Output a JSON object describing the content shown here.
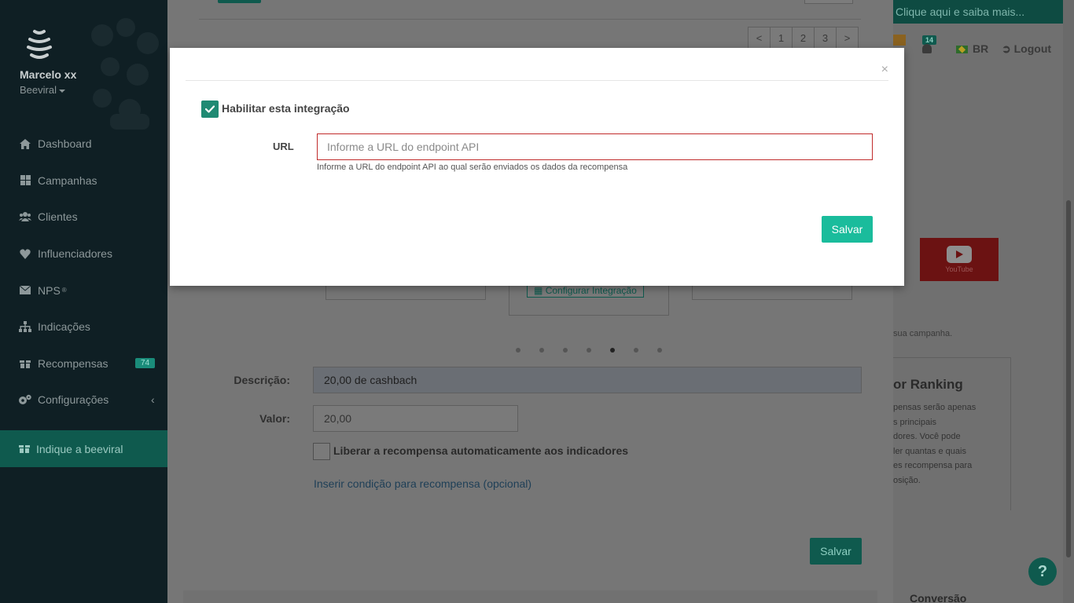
{
  "sidebar": {
    "user_name": "Marcelo xx",
    "company": "Beeviral",
    "items": [
      {
        "label": "Dashboard",
        "icon": "home-icon"
      },
      {
        "label": "Campanhas",
        "icon": "grid-icon"
      },
      {
        "label": "Clientes",
        "icon": "users-icon"
      },
      {
        "label": "Influenciadores",
        "icon": "heart-icon"
      },
      {
        "label": "NPS",
        "sup": "®",
        "icon": "envelope-icon"
      },
      {
        "label": "Indicações",
        "icon": "sitemap-icon"
      },
      {
        "label": "Recompensas",
        "badge": "74",
        "icon": "gift-icon"
      },
      {
        "label": "Configurações",
        "arrow": "‹",
        "icon": "gears-icon"
      }
    ],
    "indique": "Indique a beeviral"
  },
  "topbar": {
    "banner_text": "Clique aqui e saiba mais...",
    "notifications_count": "14",
    "language": "BR",
    "logout": "Logout"
  },
  "pagination": [
    "<",
    "1",
    "2",
    "3",
    ">"
  ],
  "background_form": {
    "config_button": "Configurar Integração",
    "descricao_label": "Descrição:",
    "descricao_value": "20,00 de cashbach",
    "valor_label": "Valor:",
    "valor_value": "20,00",
    "auto_release_label": "Liberar a recompensa automaticamente aos indicadores",
    "condition_link": "Inserir condição para recompensa (opcional)",
    "save": "Salvar",
    "carousel_dots": 7,
    "carousel_active": 5
  },
  "right_panel": {
    "youtube_label": "YouTube",
    "campaign_text": "sua campanha.",
    "ranking_title": "or Ranking",
    "ranking_lines": [
      "pensas serão apenas",
      "s principais",
      "dores. Você pode",
      "ler quantas e quais",
      "es recompensa para",
      "osição."
    ],
    "conversao": "Conversão",
    "help": "?"
  },
  "modal": {
    "close": "×",
    "enable_label": "Habilitar esta integração",
    "enable_checked": true,
    "url_label": "URL",
    "url_placeholder": "Informe a URL do endpoint API",
    "url_value": "",
    "url_help": "Informe a URL do endpoint API ao qual serão enviados os dados da recompensa",
    "save": "Salvar"
  },
  "colors": {
    "accent": "#1abc9c",
    "check": "#1f8a73",
    "error_border": "#c02b2b",
    "sidebar_bg": "#0f1f24"
  }
}
